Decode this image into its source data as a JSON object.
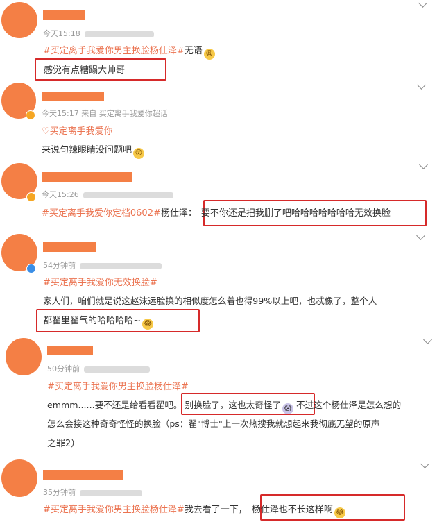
{
  "comments": [
    {
      "time": "今天15:18",
      "line1_tag": "#买定离手我爱你男主换脸杨仕泽#",
      "line1_rest": "无语",
      "line1_emoji": "😩",
      "line2": "感觉有点糟蹋大帅哥"
    },
    {
      "time": "今天15:17",
      "source": "来自 买定离手我爱你超话",
      "line1_heart": "♡",
      "line1_tag": "买定离手我爱你",
      "line2": "来说句辣眼睛没问题吧",
      "line2_emoji": "😲"
    },
    {
      "time": "今天15:26",
      "line1_tag": "#买定离手我爱你定档0602#",
      "line1_rest": "杨仕泽：",
      "line1_boxed": "要不你还是把我删了吧哈哈哈哈哈哈哈无效换脸"
    },
    {
      "time": "54分钟前",
      "line1_tag": "#买定离手我爱你无效换脸#",
      "line2": "家人们，咱们就是说这赵沫远脸换的相似度怎么着也得99%以上吧，也忒像了，整个人",
      "line3": "都翟里翟气的哈哈哈哈~",
      "line3_emoji": "😂"
    },
    {
      "time": "50分钟前",
      "line1_tag": "#买定离手我爱你男主换脸杨仕泽#",
      "line2_a": "emmm......要不还是给看看翟吧。",
      "line2_boxed": "别换脸了，这也太奇怪了",
      "line2_emoji": "😱",
      "line2_b": "不过这个杨仕泽是怎么想的",
      "line3": "怎么会接这种奇奇怪怪的换脸（ps：翟\"博士\"上一次热搜我就想起来我彻底无望的原声",
      "line4": "之罪2）"
    },
    {
      "time": "35分钟前",
      "line1_tag": "#买定离手我爱你男主换脸杨仕泽#",
      "line1_rest": "我去看了一下，",
      "line1_boxed": "杨仕泽也不长这样啊",
      "line1_emoji": "😂"
    }
  ],
  "icons": {
    "expand": "chevron-down-icon",
    "verified_gold": "verified-badge-gold-icon",
    "verified_blue": "verified-badge-blue-icon"
  },
  "colors": {
    "avatar": "#f47f45",
    "topic": "#eb7350",
    "highlight_box": "#d62a2a",
    "meta_text": "#999999"
  }
}
